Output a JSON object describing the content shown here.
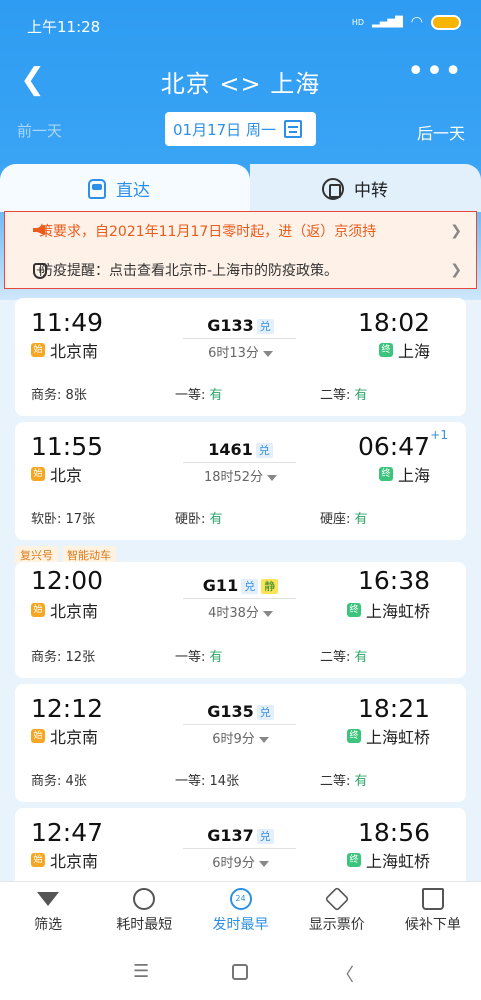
{
  "status_bar": {
    "time": "上午11:28",
    "network": "HD",
    "signal": "▂▄▆█",
    "wifi": "wifi"
  },
  "nav": {
    "back_icon": "chevron-left",
    "title": "北京 <> 上海",
    "more_icon": "•••"
  },
  "date_bar": {
    "prev_day": "前一天",
    "date": "01月17日 周一",
    "next_day": "后一天"
  },
  "tabs": [
    {
      "label": "直达",
      "active": true,
      "icon": "train-icon"
    },
    {
      "label": "中转",
      "active": false,
      "icon": "transfer-icon"
    }
  ],
  "notices": [
    {
      "text": "策要求，自2021年11月17日零时起，进（返）京须持",
      "icon": "speaker-icon",
      "color": "#ea5b1c"
    },
    {
      "text": "防疫提醒：点击查看北京市-上海市的防疫政策。",
      "icon": "shield-icon"
    }
  ],
  "trains": [
    {
      "dep_time": "11:49",
      "arr_time": "18:02",
      "train_no": "G133",
      "tags": [
        "兑"
      ],
      "duration": "6时13分",
      "dep_station": "北京南",
      "arr_station": "上海",
      "plus_day": "",
      "seats": [
        {
          "type": "商务:",
          "count": "8张",
          "avail": false
        },
        {
          "type": "一等:",
          "count": "有",
          "avail": true
        },
        {
          "type": "二等:",
          "count": "有",
          "avail": true
        }
      ]
    },
    {
      "dep_time": "11:55",
      "arr_time": "06:47",
      "train_no": "1461",
      "tags": [
        "兑"
      ],
      "duration": "18时52分",
      "dep_station": "北京",
      "arr_station": "上海",
      "plus_day": "+1",
      "seats": [
        {
          "type": "软卧:",
          "count": "17张",
          "avail": false
        },
        {
          "type": "硬卧:",
          "count": "有",
          "avail": true
        },
        {
          "type": "硬座:",
          "count": "有",
          "avail": true
        }
      ]
    },
    {
      "dep_time": "12:00",
      "arr_time": "16:38",
      "train_no": "G11",
      "tags": [
        "兑",
        "静"
      ],
      "duration": "4时38分",
      "dep_station": "北京南",
      "arr_station": "上海虹桥",
      "plus_day": "",
      "features": [
        "复兴号",
        "智能动车"
      ],
      "seats": [
        {
          "type": "商务:",
          "count": "12张",
          "avail": false
        },
        {
          "type": "一等:",
          "count": "有",
          "avail": true
        },
        {
          "type": "二等:",
          "count": "有",
          "avail": true
        }
      ]
    },
    {
      "dep_time": "12:12",
      "arr_time": "18:21",
      "train_no": "G135",
      "tags": [
        "兑"
      ],
      "duration": "6时9分",
      "dep_station": "北京南",
      "arr_station": "上海虹桥",
      "plus_day": "",
      "seats": [
        {
          "type": "商务:",
          "count": "4张",
          "avail": false
        },
        {
          "type": "一等:",
          "count": "14张",
          "avail": false
        },
        {
          "type": "二等:",
          "count": "有",
          "avail": true
        }
      ]
    },
    {
      "dep_time": "12:47",
      "arr_time": "18:56",
      "train_no": "G137",
      "tags": [
        "兑"
      ],
      "duration": "6时9分",
      "dep_station": "北京南",
      "arr_station": "上海虹桥",
      "plus_day": ""
    }
  ],
  "station_badges": {
    "dep": "始",
    "arr": "终"
  },
  "bottom_bar": [
    {
      "label": "筛选",
      "icon": "filter-icon",
      "active": false
    },
    {
      "label": "耗时最短",
      "icon": "timer-icon",
      "active": false
    },
    {
      "label": "发时最早",
      "icon": "clock-24-icon",
      "active": true,
      "icon_text": "24"
    },
    {
      "label": "显示票价",
      "icon": "price-tag-icon",
      "active": false
    },
    {
      "label": "候补下单",
      "icon": "cart-icon",
      "active": false
    }
  ],
  "system_nav": {
    "menu": "☰",
    "back": "〈"
  },
  "colors": {
    "primary": "#2c8fe8",
    "header": "#2e9cf2",
    "available": "#2fa46a",
    "notice": "#ea5b1c"
  }
}
